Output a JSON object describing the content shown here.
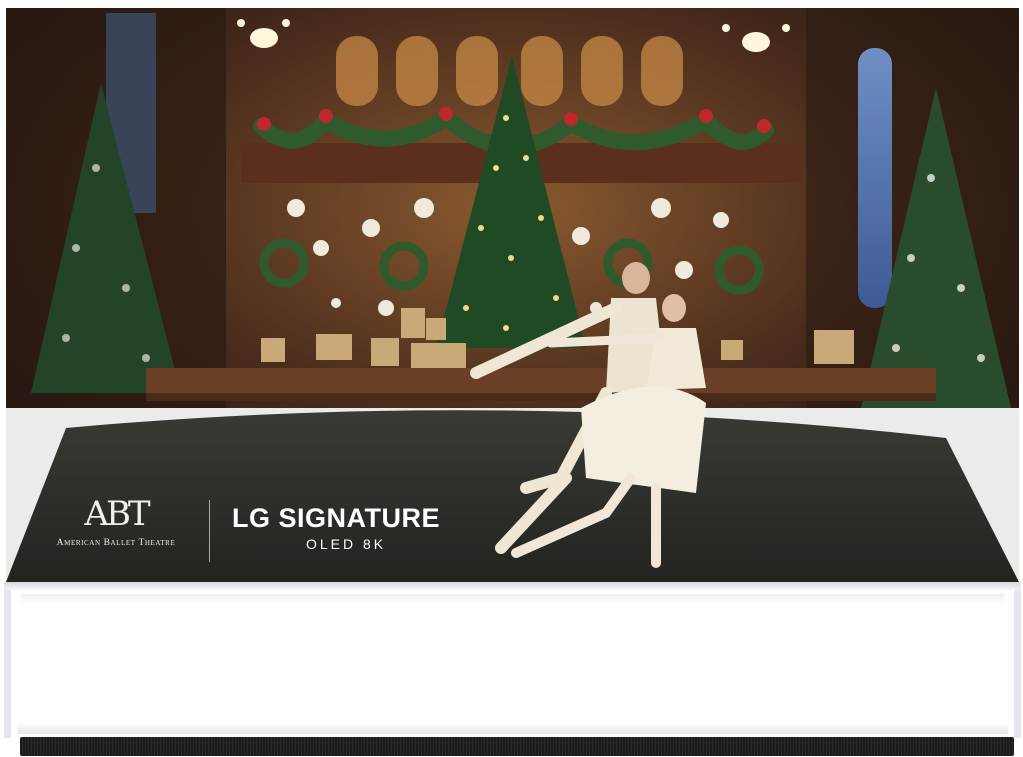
{
  "screen": {
    "image_description_icon": "tv-screen",
    "abt_logo": {
      "monogram": "ABT",
      "name": "American Ballet Theatre"
    },
    "lg_logo": {
      "brand": "LG SIGNATURE",
      "model": "OLED 8K"
    }
  },
  "colors": {
    "wall": "#3a2418",
    "wood": "#5a3420",
    "tree": "#1f4a24",
    "light": "#f4d98a",
    "snow": "#e9ece9",
    "floor": "#2c2d2a",
    "costume": "#efe6d3",
    "ribbon": "#c0262c"
  }
}
